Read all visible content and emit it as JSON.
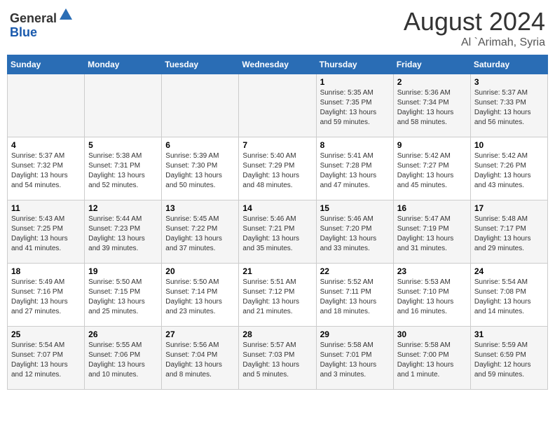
{
  "header": {
    "logo_line1": "General",
    "logo_line2": "Blue",
    "month_year": "August 2024",
    "location": "Al `Arimah, Syria"
  },
  "weekdays": [
    "Sunday",
    "Monday",
    "Tuesday",
    "Wednesday",
    "Thursday",
    "Friday",
    "Saturday"
  ],
  "weeks": [
    [
      {
        "day": "",
        "info": ""
      },
      {
        "day": "",
        "info": ""
      },
      {
        "day": "",
        "info": ""
      },
      {
        "day": "",
        "info": ""
      },
      {
        "day": "1",
        "info": "Sunrise: 5:35 AM\nSunset: 7:35 PM\nDaylight: 13 hours\nand 59 minutes."
      },
      {
        "day": "2",
        "info": "Sunrise: 5:36 AM\nSunset: 7:34 PM\nDaylight: 13 hours\nand 58 minutes."
      },
      {
        "day": "3",
        "info": "Sunrise: 5:37 AM\nSunset: 7:33 PM\nDaylight: 13 hours\nand 56 minutes."
      }
    ],
    [
      {
        "day": "4",
        "info": "Sunrise: 5:37 AM\nSunset: 7:32 PM\nDaylight: 13 hours\nand 54 minutes."
      },
      {
        "day": "5",
        "info": "Sunrise: 5:38 AM\nSunset: 7:31 PM\nDaylight: 13 hours\nand 52 minutes."
      },
      {
        "day": "6",
        "info": "Sunrise: 5:39 AM\nSunset: 7:30 PM\nDaylight: 13 hours\nand 50 minutes."
      },
      {
        "day": "7",
        "info": "Sunrise: 5:40 AM\nSunset: 7:29 PM\nDaylight: 13 hours\nand 48 minutes."
      },
      {
        "day": "8",
        "info": "Sunrise: 5:41 AM\nSunset: 7:28 PM\nDaylight: 13 hours\nand 47 minutes."
      },
      {
        "day": "9",
        "info": "Sunrise: 5:42 AM\nSunset: 7:27 PM\nDaylight: 13 hours\nand 45 minutes."
      },
      {
        "day": "10",
        "info": "Sunrise: 5:42 AM\nSunset: 7:26 PM\nDaylight: 13 hours\nand 43 minutes."
      }
    ],
    [
      {
        "day": "11",
        "info": "Sunrise: 5:43 AM\nSunset: 7:25 PM\nDaylight: 13 hours\nand 41 minutes."
      },
      {
        "day": "12",
        "info": "Sunrise: 5:44 AM\nSunset: 7:23 PM\nDaylight: 13 hours\nand 39 minutes."
      },
      {
        "day": "13",
        "info": "Sunrise: 5:45 AM\nSunset: 7:22 PM\nDaylight: 13 hours\nand 37 minutes."
      },
      {
        "day": "14",
        "info": "Sunrise: 5:46 AM\nSunset: 7:21 PM\nDaylight: 13 hours\nand 35 minutes."
      },
      {
        "day": "15",
        "info": "Sunrise: 5:46 AM\nSunset: 7:20 PM\nDaylight: 13 hours\nand 33 minutes."
      },
      {
        "day": "16",
        "info": "Sunrise: 5:47 AM\nSunset: 7:19 PM\nDaylight: 13 hours\nand 31 minutes."
      },
      {
        "day": "17",
        "info": "Sunrise: 5:48 AM\nSunset: 7:17 PM\nDaylight: 13 hours\nand 29 minutes."
      }
    ],
    [
      {
        "day": "18",
        "info": "Sunrise: 5:49 AM\nSunset: 7:16 PM\nDaylight: 13 hours\nand 27 minutes."
      },
      {
        "day": "19",
        "info": "Sunrise: 5:50 AM\nSunset: 7:15 PM\nDaylight: 13 hours\nand 25 minutes."
      },
      {
        "day": "20",
        "info": "Sunrise: 5:50 AM\nSunset: 7:14 PM\nDaylight: 13 hours\nand 23 minutes."
      },
      {
        "day": "21",
        "info": "Sunrise: 5:51 AM\nSunset: 7:12 PM\nDaylight: 13 hours\nand 21 minutes."
      },
      {
        "day": "22",
        "info": "Sunrise: 5:52 AM\nSunset: 7:11 PM\nDaylight: 13 hours\nand 18 minutes."
      },
      {
        "day": "23",
        "info": "Sunrise: 5:53 AM\nSunset: 7:10 PM\nDaylight: 13 hours\nand 16 minutes."
      },
      {
        "day": "24",
        "info": "Sunrise: 5:54 AM\nSunset: 7:08 PM\nDaylight: 13 hours\nand 14 minutes."
      }
    ],
    [
      {
        "day": "25",
        "info": "Sunrise: 5:54 AM\nSunset: 7:07 PM\nDaylight: 13 hours\nand 12 minutes."
      },
      {
        "day": "26",
        "info": "Sunrise: 5:55 AM\nSunset: 7:06 PM\nDaylight: 13 hours\nand 10 minutes."
      },
      {
        "day": "27",
        "info": "Sunrise: 5:56 AM\nSunset: 7:04 PM\nDaylight: 13 hours\nand 8 minutes."
      },
      {
        "day": "28",
        "info": "Sunrise: 5:57 AM\nSunset: 7:03 PM\nDaylight: 13 hours\nand 5 minutes."
      },
      {
        "day": "29",
        "info": "Sunrise: 5:58 AM\nSunset: 7:01 PM\nDaylight: 13 hours\nand 3 minutes."
      },
      {
        "day": "30",
        "info": "Sunrise: 5:58 AM\nSunset: 7:00 PM\nDaylight: 13 hours\nand 1 minute."
      },
      {
        "day": "31",
        "info": "Sunrise: 5:59 AM\nSunset: 6:59 PM\nDaylight: 12 hours\nand 59 minutes."
      }
    ]
  ]
}
